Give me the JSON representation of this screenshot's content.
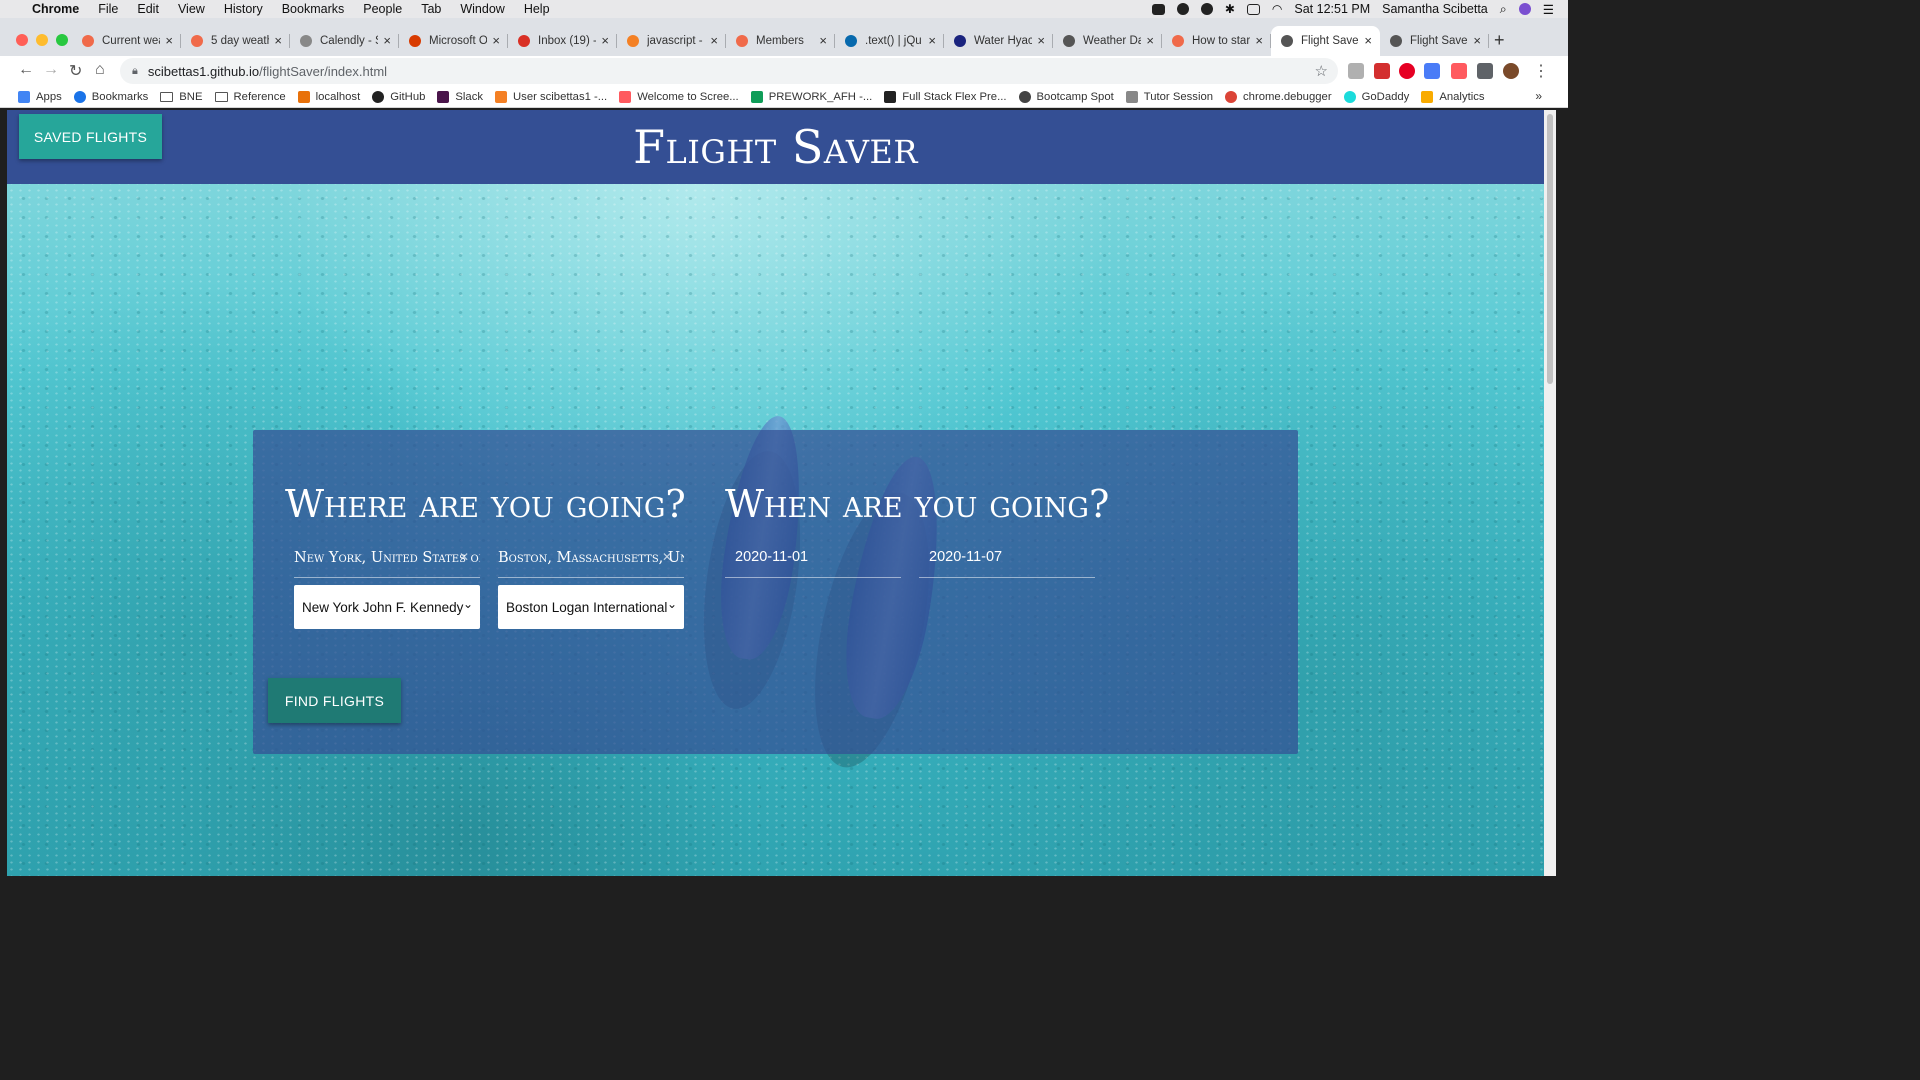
{
  "menubar": {
    "app": "Chrome",
    "items": [
      "File",
      "Edit",
      "View",
      "History",
      "Bookmarks",
      "People",
      "Tab",
      "Window",
      "Help"
    ],
    "clock": "Sat 12:51 PM",
    "user": "Samantha Scibetta"
  },
  "tabs": [
    {
      "title": "Current wea",
      "color": "#f06a4a"
    },
    {
      "title": "5 day weath",
      "color": "#f06a4a"
    },
    {
      "title": "Calendly - S",
      "color": "#888888"
    },
    {
      "title": "Microsoft O",
      "color": "#d83b01"
    },
    {
      "title": "Inbox (19) -",
      "color": "#d93025"
    },
    {
      "title": "javascript -",
      "color": "#f48024"
    },
    {
      "title": "Members",
      "color": "#f06a4a"
    },
    {
      "title": ".text() | jQu",
      "color": "#0769ad"
    },
    {
      "title": "Water Hyac",
      "color": "#1a237e"
    },
    {
      "title": "Weather Da",
      "color": "#555555"
    },
    {
      "title": "How to star",
      "color": "#f06a4a"
    },
    {
      "title": "Flight Saver",
      "color": "#555555",
      "active": true
    },
    {
      "title": "Flight Saver",
      "color": "#555555"
    }
  ],
  "address": {
    "host": "scibettas1.github.io",
    "path": "/flightSaver/index.html"
  },
  "bookmarks": [
    {
      "label": "Apps",
      "icon": "apps-grid-icon",
      "color": "#4285f4"
    },
    {
      "label": "Bookmarks",
      "icon": "star-icon",
      "color": "#1a73e8"
    },
    {
      "label": "BNE",
      "icon": "folder-icon"
    },
    {
      "label": "Reference",
      "icon": "folder-icon"
    },
    {
      "label": "localhost",
      "icon": "localhost-icon",
      "color": "#e8710a"
    },
    {
      "label": "GitHub",
      "icon": "github-icon",
      "color": "#222222"
    },
    {
      "label": "Slack",
      "icon": "slack-icon",
      "color": "#4a154b"
    },
    {
      "label": "User scibettas1 -...",
      "icon": "stackoverflow-icon",
      "color": "#f48024"
    },
    {
      "label": "Welcome to Scree...",
      "icon": "screencastify-icon",
      "color": "#ff5a5f"
    },
    {
      "label": "PREWORK_AFH -...",
      "icon": "drive-icon",
      "color": "#0f9d58"
    },
    {
      "label": "Full Stack Flex Pre...",
      "icon": "book-icon",
      "color": "#222222"
    },
    {
      "label": "Bootcamp Spot",
      "icon": "globe-icon",
      "color": "#444444"
    },
    {
      "label": "Tutor Session",
      "icon": "page-icon",
      "color": "#888888"
    },
    {
      "label": "chrome.debugger",
      "icon": "chrome-icon",
      "color": "#db4437"
    },
    {
      "label": "GoDaddy",
      "icon": "godaddy-icon",
      "color": "#1bdbdb"
    },
    {
      "label": "Analytics",
      "icon": "analytics-icon",
      "color": "#f9ab00"
    }
  ],
  "page": {
    "saved_button": "Saved Flights",
    "title": "Flight Saver",
    "where_title": "Where are you going?",
    "when_title": "When are you going?",
    "origin_city": "New York, United States of",
    "destination_city": "Boston, Massachusetts, Un",
    "origin_airport": "New York John F. Kennedy",
    "destination_airport": "Boston Logan International",
    "depart_date": "2020-11-01",
    "return_date": "2020-11-07",
    "find_button": "Find Flights"
  },
  "colors": {
    "header": "#344f94",
    "saved_button": "#26a69a",
    "find_button": "#1f7a74",
    "card": "rgba(52,79,148,0.72)"
  }
}
